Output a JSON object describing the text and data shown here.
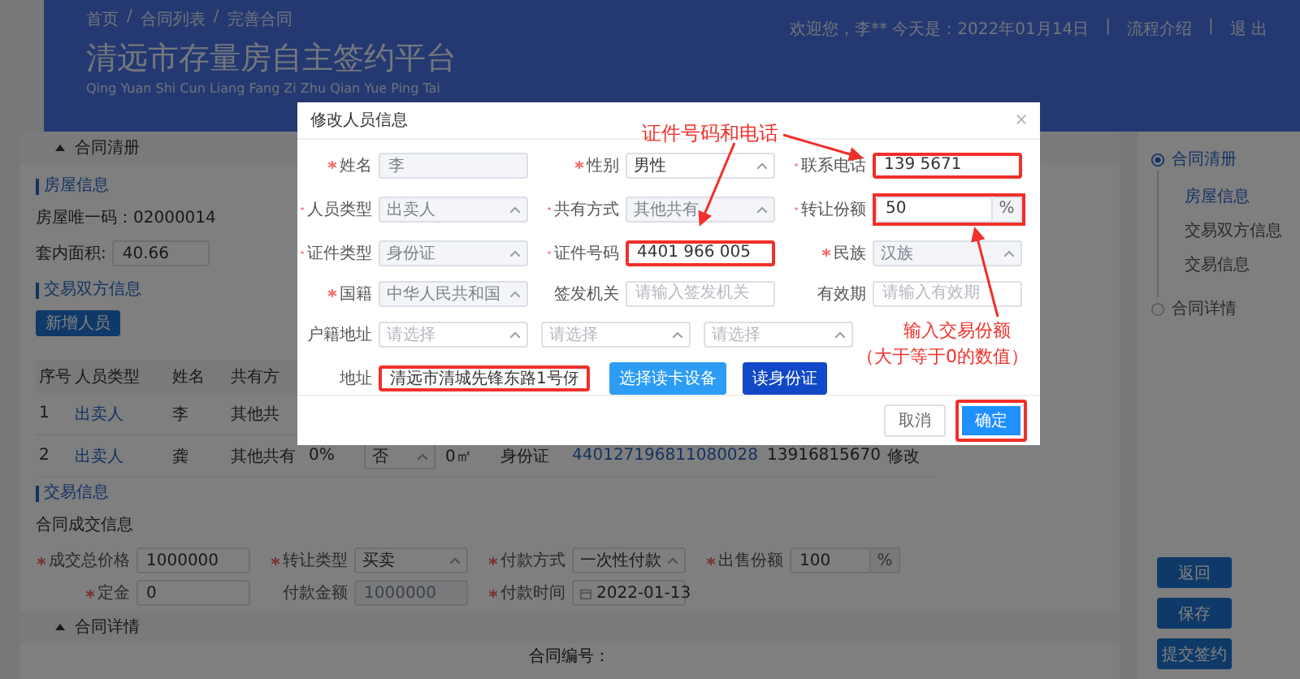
{
  "header": {
    "breadcrumb": [
      "首页",
      "合同列表",
      "完善合同"
    ],
    "breadcrumb_separator": "/",
    "title": "清远市存量房自主签约平台",
    "subtitle": "Qing Yuan Shi Cun Liang Fang Zi Zhu Qian Yue Ping Tai",
    "welcome": "欢迎您，李** 今天是：2022年01月14日",
    "links": [
      "流程介绍",
      "退 出"
    ],
    "link_separator": "|"
  },
  "contract_panel": {
    "title": "合同清册",
    "expanded": true
  },
  "house": {
    "title": "房屋信息",
    "unique_code": "房屋唯一码：02000014",
    "area_label": "套内面积:",
    "area_value": "40.66"
  },
  "parties": {
    "title": "交易双方信息",
    "add_button": "新增人员",
    "columns": [
      "序号",
      "人员类型",
      "姓名",
      "共有方"
    ],
    "rows": [
      {
        "cells": [
          {
            "kind": "text",
            "text": "1"
          },
          {
            "kind": "link",
            "text": "出卖人"
          },
          {
            "kind": "text",
            "text": "李"
          },
          {
            "kind": "text",
            "text": "其他共"
          }
        ]
      },
      {
        "cells": [
          {
            "kind": "text",
            "text": "2"
          },
          {
            "kind": "link",
            "text": "出卖人"
          },
          {
            "kind": "text",
            "text": "龚"
          },
          {
            "kind": "text",
            "text": "其他共有"
          },
          {
            "kind": "text",
            "text": "0%"
          },
          {
            "kind": "select",
            "text": "否"
          },
          {
            "kind": "text",
            "text": "0㎡"
          },
          {
            "kind": "text",
            "text": "身份证"
          },
          {
            "kind": "link",
            "text": "440127196811080028"
          },
          {
            "kind": "text",
            "text": "13916815670"
          },
          {
            "kind": "text",
            "text": "修改"
          }
        ]
      }
    ]
  },
  "trade": {
    "title": "交易信息",
    "subtitle": "合同成交信息",
    "fields": [
      {
        "label": "成交总价格",
        "required": true,
        "kind": "input",
        "value": "1000000",
        "disabled": false
      },
      {
        "label": "转让类型",
        "required": true,
        "kind": "select",
        "value": "买卖",
        "disabled": false
      },
      {
        "label": "付款方式",
        "required": true,
        "kind": "select",
        "value": "一次性付款",
        "disabled": false
      },
      {
        "label": "出售份额",
        "required": true,
        "kind": "percent",
        "value": "100",
        "suffix": "%",
        "disabled": false
      },
      {
        "label": "定金",
        "required": true,
        "kind": "input",
        "value": "0",
        "disabled": false
      },
      {
        "label": "付款金额",
        "required": false,
        "kind": "input",
        "value": "1000000",
        "disabled": true
      },
      {
        "label": "付款时间",
        "required": true,
        "kind": "date",
        "value": "2022-01-13",
        "disabled": false
      }
    ]
  },
  "details_panel": {
    "title": "合同详情",
    "expanded": true,
    "contract_no_label": "合同编号："
  },
  "side_nav": [
    {
      "label": "合同清册",
      "selected": true,
      "children": [
        {
          "label": "房屋信息",
          "selected": true
        },
        {
          "label": "交易双方信息",
          "selected": false
        },
        {
          "label": "交易信息",
          "selected": false
        }
      ]
    },
    {
      "label": "合同详情",
      "selected": false
    }
  ],
  "side_buttons": [
    "返回",
    "保存",
    "提交签约"
  ],
  "modal": {
    "title": "修改人员信息",
    "fields": [
      {
        "label": "姓名",
        "required": true,
        "kind": "input",
        "value": "李",
        "disabled": true,
        "highlighted": false
      },
      {
        "label": "性别",
        "required": true,
        "kind": "select",
        "value": "男性",
        "disabled": false,
        "highlighted": false
      },
      {
        "label": "联系电话",
        "required": true,
        "kind": "input",
        "value": "139 5671",
        "disabled": false,
        "highlighted": true
      },
      {
        "label": "人员类型",
        "required": true,
        "kind": "select",
        "value": "出卖人",
        "disabled": true,
        "highlighted": false
      },
      {
        "label": "共有方式",
        "required": true,
        "kind": "select",
        "value": "其他共有",
        "disabled": true,
        "highlighted": false
      },
      {
        "label": "转让份额",
        "required": true,
        "kind": "percent",
        "value": "50",
        "suffix": "%",
        "disabled": false,
        "highlighted": true
      },
      {
        "label": "证件类型",
        "required": true,
        "kind": "select",
        "value": "身份证",
        "disabled": true,
        "highlighted": false
      },
      {
        "label": "证件号码",
        "required": true,
        "kind": "input",
        "value": "4401 966 005",
        "disabled": false,
        "highlighted": true
      },
      {
        "label": "民族",
        "required": true,
        "kind": "select",
        "value": "汉族",
        "disabled": true,
        "highlighted": false
      },
      {
        "label": "国籍",
        "required": true,
        "kind": "select",
        "value": "中华人民共和国",
        "disabled": true,
        "highlighted": false
      },
      {
        "label": "签发机关",
        "required": false,
        "kind": "input",
        "placeholder": "请输入签发机关",
        "disabled": false,
        "highlighted": false
      },
      {
        "label": "有效期",
        "required": false,
        "kind": "input",
        "placeholder": "请输入有效期",
        "disabled": false,
        "highlighted": false
      }
    ],
    "household": {
      "label": "户籍地址",
      "placeholders": [
        "请选择",
        "请选择",
        "请选择"
      ]
    },
    "address": {
      "label": "地址",
      "value": "清远市清城先锋东路1号伢",
      "highlighted": true
    },
    "action_buttons": [
      {
        "label": "选择读卡设备",
        "kind": "secondary"
      },
      {
        "label": "读身份证",
        "kind": "primary"
      }
    ],
    "footer_buttons": [
      {
        "label": "取消",
        "kind": "default",
        "highlighted": false
      },
      {
        "label": "确定",
        "kind": "primary",
        "highlighted": true
      }
    ]
  },
  "annotations": [
    {
      "text": "证件号码和电话"
    },
    {
      "text": "输入交易份额",
      "note": "（大于等于0的数值）"
    }
  ]
}
